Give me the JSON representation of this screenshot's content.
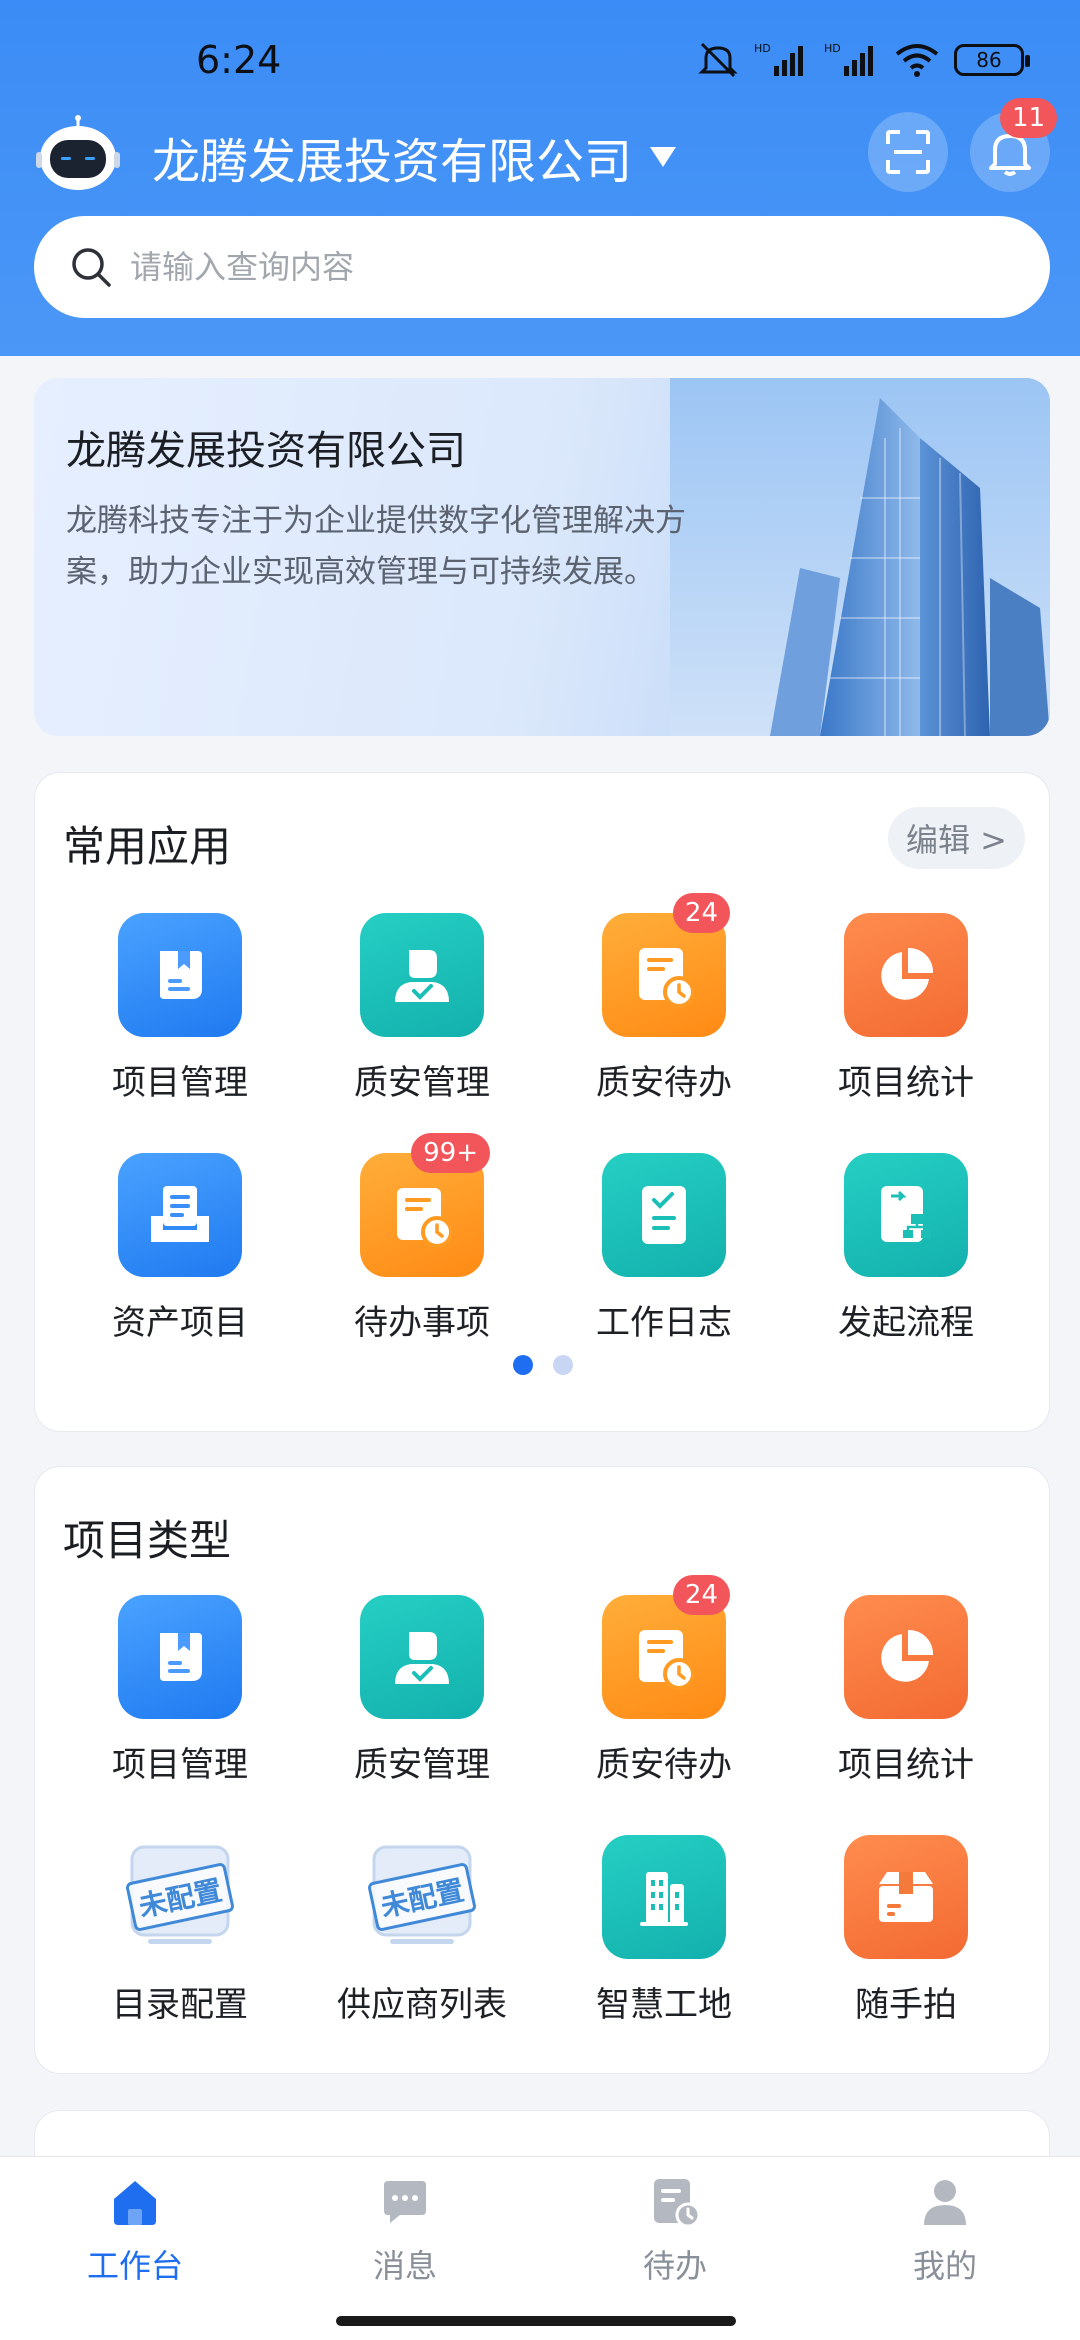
{
  "status": {
    "time": "6:24",
    "battery": "86"
  },
  "header": {
    "company": "龙腾发展投资有限公司",
    "notification_count": "11"
  },
  "search": {
    "placeholder": "请输入查询内容"
  },
  "banner": {
    "title": "龙腾发展投资有限公司",
    "text": "龙腾科技专注于为企业提供数字化管理解决方案，助力企业实现高效管理与可持续发展。"
  },
  "common_apps": {
    "title": "常用应用",
    "edit_label": "编辑 >",
    "items": [
      {
        "label": "项目管理",
        "badge": ""
      },
      {
        "label": "质安管理",
        "badge": ""
      },
      {
        "label": "质安待办",
        "badge": "24"
      },
      {
        "label": "项目统计",
        "badge": ""
      },
      {
        "label": "资产项目",
        "badge": ""
      },
      {
        "label": "待办事项",
        "badge": "99+"
      },
      {
        "label": "工作日志",
        "badge": ""
      },
      {
        "label": "发起流程",
        "badge": ""
      }
    ]
  },
  "project_types": {
    "title": "项目类型",
    "items": [
      {
        "label": "项目管理",
        "badge": ""
      },
      {
        "label": "质安管理",
        "badge": ""
      },
      {
        "label": "质安待办",
        "badge": "24"
      },
      {
        "label": "项目统计",
        "badge": ""
      },
      {
        "label": "目录配置",
        "stamp": "未配置"
      },
      {
        "label": "供应商列表",
        "stamp": "未配置"
      },
      {
        "label": "智慧工地"
      },
      {
        "label": "随手拍"
      }
    ]
  },
  "tabs": [
    {
      "label": "工作台"
    },
    {
      "label": "消息"
    },
    {
      "label": "待办"
    },
    {
      "label": "我的"
    }
  ]
}
